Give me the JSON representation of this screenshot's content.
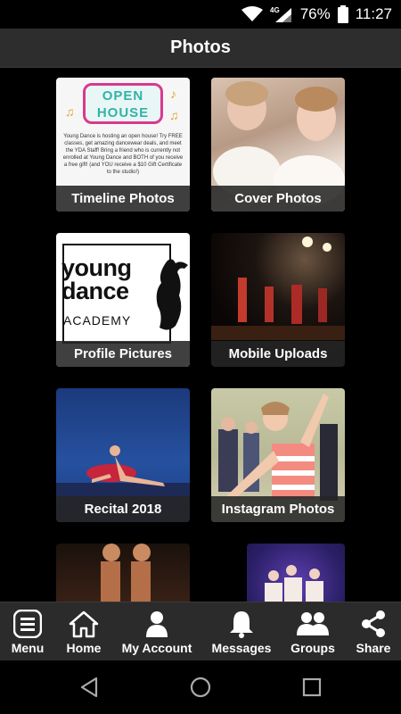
{
  "status_bar": {
    "network": "4G",
    "battery": "76%",
    "time": "11:27"
  },
  "header": {
    "title": "Photos"
  },
  "albums": [
    {
      "label": "Timeline Photos"
    },
    {
      "label": "Cover Photos"
    },
    {
      "label": "Profile Pictures"
    },
    {
      "label": "Mobile Uploads"
    },
    {
      "label": "Recital 2018"
    },
    {
      "label": "Instagram Photos"
    }
  ],
  "open_house_poster": {
    "title_line1": "OPEN",
    "title_line2": "HOUSE",
    "body": "Young Dance is hosting an open house! Try FREE classes, get amazing dancewear deals, and meet the YDA Staff! Bring a friend who is currently not enrolled at Young Dance and BOTH of you receive a free gift! (and YOU receive a $10 Gift Certificate to the studio!)"
  },
  "logo": {
    "line1": "young",
    "line2": "dance",
    "line3": "ACADEMY"
  },
  "bottom_nav": [
    {
      "label": "Menu",
      "icon": "menu-icon"
    },
    {
      "label": "Home",
      "icon": "home-icon"
    },
    {
      "label": "My Account",
      "icon": "user-icon"
    },
    {
      "label": "Messages",
      "icon": "bell-icon"
    },
    {
      "label": "Groups",
      "icon": "group-icon"
    },
    {
      "label": "Share",
      "icon": "share-icon"
    }
  ],
  "system_nav": {
    "back": "back-icon",
    "home": "circle-home-icon",
    "recents": "recents-icon"
  },
  "colors": {
    "header_bg": "#2d2d2d",
    "nav_bg": "#2b2b2b",
    "background": "#000000"
  }
}
